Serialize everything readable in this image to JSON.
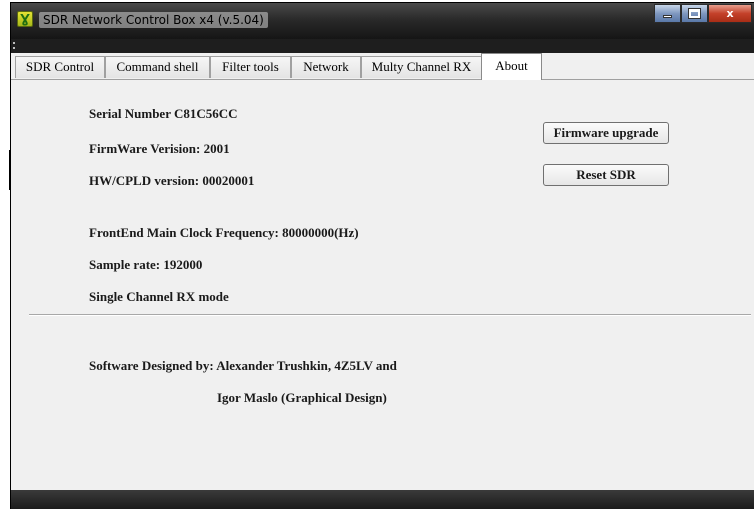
{
  "window": {
    "title": "SDR Network Control Box x4 (v.5.04)",
    "app_icon_glyph": "Ɣ",
    "controls": {
      "close_glyph": "x"
    }
  },
  "tabs": [
    {
      "label": "SDR Control"
    },
    {
      "label": "Command shell"
    },
    {
      "label": "Filter tools"
    },
    {
      "label": "Network"
    },
    {
      "label": "Multy Channel RX"
    },
    {
      "label": "About"
    }
  ],
  "about": {
    "serial_number": "Serial Number  C81C56CC",
    "firmware_version": "FirmWare Verision: 2001",
    "hw_cpld_version": "HW/CPLD version: 00020001",
    "clock_frequency": "FrontEnd Main Clock Frequency:  80000000(Hz)",
    "sample_rate": "Sample rate:  192000",
    "rx_mode": "Single Channel RX mode",
    "credits_line1": "Software Designed by:  Alexander Trushkin, 4Z5LV and",
    "credits_line2": "Igor Maslo (Graphical Design)",
    "firmware_upgrade_button": "Firmware upgrade",
    "reset_sdr_button": "Reset SDR"
  },
  "colors": {
    "titlebar": "#2a2a2a",
    "client_bg": "#f0f0f0",
    "close_button": "#c4412a"
  }
}
